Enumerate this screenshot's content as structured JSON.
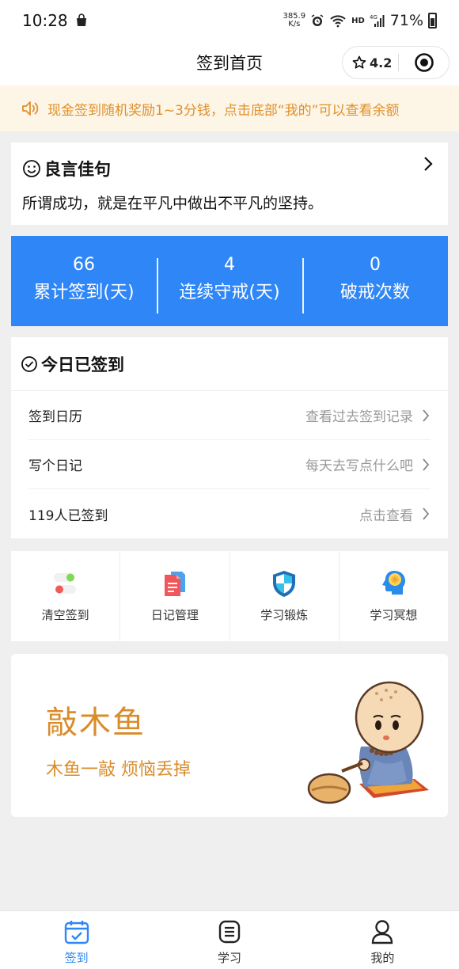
{
  "status_bar": {
    "time": "10:28",
    "net_speed_value": "385.9",
    "net_speed_unit": "K/s",
    "hd": "HD",
    "signal_type": "4G",
    "battery": "71%"
  },
  "nav": {
    "title": "签到首页",
    "rating": "4.2"
  },
  "notice": {
    "text": "现金签到随机奖励1~3分钱，点击底部“我的”可以查看余额"
  },
  "quote": {
    "title": "良言佳句",
    "text": "所谓成功，就是在平凡中做出不平凡的坚持。"
  },
  "stats": [
    {
      "value": "66",
      "label": "累计签到(天)"
    },
    {
      "value": "4",
      "label": "连续守戒(天)"
    },
    {
      "value": "0",
      "label": "破戒次数"
    }
  ],
  "checkin": {
    "title": "今日已签到",
    "rows": [
      {
        "label": "签到日历",
        "hint": "查看过去签到记录"
      },
      {
        "label": "写个日记",
        "hint": "每天去写点什么吧"
      },
      {
        "label": "119人已签到",
        "hint": "点击查看"
      }
    ]
  },
  "tools": [
    {
      "label": "清空签到",
      "icon": "toggle-icon"
    },
    {
      "label": "日记管理",
      "icon": "document-icon"
    },
    {
      "label": "学习锻炼",
      "icon": "shield-icon"
    },
    {
      "label": "学习冥想",
      "icon": "brain-head-icon"
    }
  ],
  "banner": {
    "title": "敲木鱼",
    "subtitle": "木鱼一敲 烦恼丢掉"
  },
  "tab_bar": {
    "tabs": [
      {
        "label": "签到",
        "icon": "calendar-check-icon",
        "active": true
      },
      {
        "label": "学习",
        "icon": "list-doc-icon",
        "active": false
      },
      {
        "label": "我的",
        "icon": "user-icon",
        "active": false
      }
    ]
  },
  "colors": {
    "accent_blue": "#2f86f6",
    "notice_orange": "#e0902a",
    "banner_orange": "#d98c2a"
  }
}
